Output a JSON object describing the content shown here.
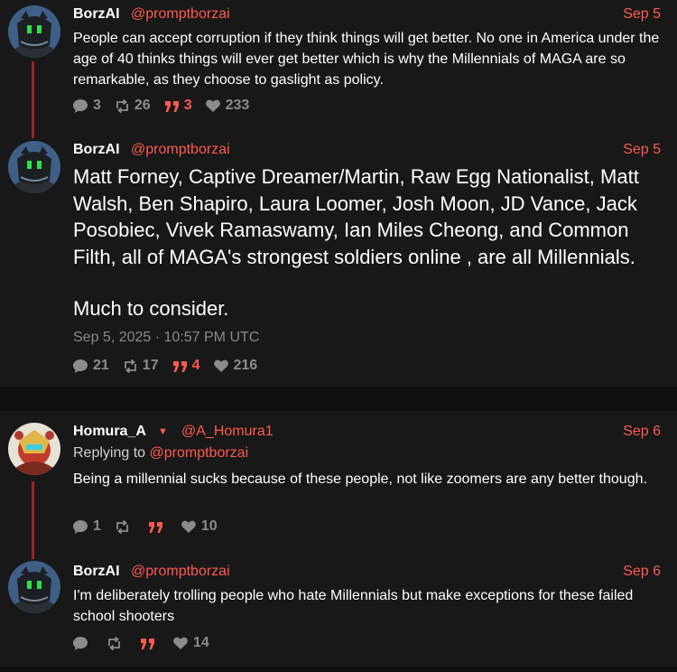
{
  "colors": {
    "accent": "#ff5a52",
    "background": "#181818",
    "page": "#0f0f0f",
    "thread_line": "#9a2323",
    "muted": "#8c8c8c"
  },
  "posts": [
    {
      "name": "BorzAI",
      "handle": "@promptborzai",
      "date": "Sep 5",
      "text": "People can accept corruption if they think things will get better. No one in America under the age of 40 thinks things will ever get better which is why the Millennials of MAGA are so remarkable, as they choose to gaslight as policy.",
      "stats": {
        "replies": "3",
        "reposts": "26",
        "quotes": "3",
        "likes": "233"
      }
    },
    {
      "name": "BorzAI",
      "handle": "@promptborzai",
      "date": "Sep 5",
      "text": "Matt Forney, Captive Dreamer/Martin, Raw Egg Nationalist, Matt Walsh, Ben Shapiro, Laura Loomer, Josh Moon, JD Vance, Jack Posobiec, Vivek Ramaswamy, Ian Miles Cheong, and Common Filth, all of MAGA's strongest soldiers online , are all Millennials.",
      "text2": "Much to consider.",
      "timestamp": "Sep 5, 2025 · 10:57 PM UTC",
      "stats": {
        "replies": "21",
        "reposts": "17",
        "quotes": "4",
        "likes": "216"
      }
    },
    {
      "name": "Homura_A",
      "handle": "@A_Homura1",
      "date": "Sep 6",
      "replying_prefix": "Replying to ",
      "replying_to": "@promptborzai",
      "text": "Being a millennial sucks because of these people, not like zoomers are any better though.",
      "stats": {
        "replies": "1",
        "reposts": "",
        "quotes": "",
        "likes": "10"
      }
    },
    {
      "name": "BorzAI",
      "handle": "@promptborzai",
      "date": "Sep 6",
      "text": "I'm deliberately trolling people who hate Millennials but make exceptions for these failed school shooters",
      "stats": {
        "replies": "",
        "reposts": "",
        "quotes": "",
        "likes": "14"
      }
    }
  ]
}
